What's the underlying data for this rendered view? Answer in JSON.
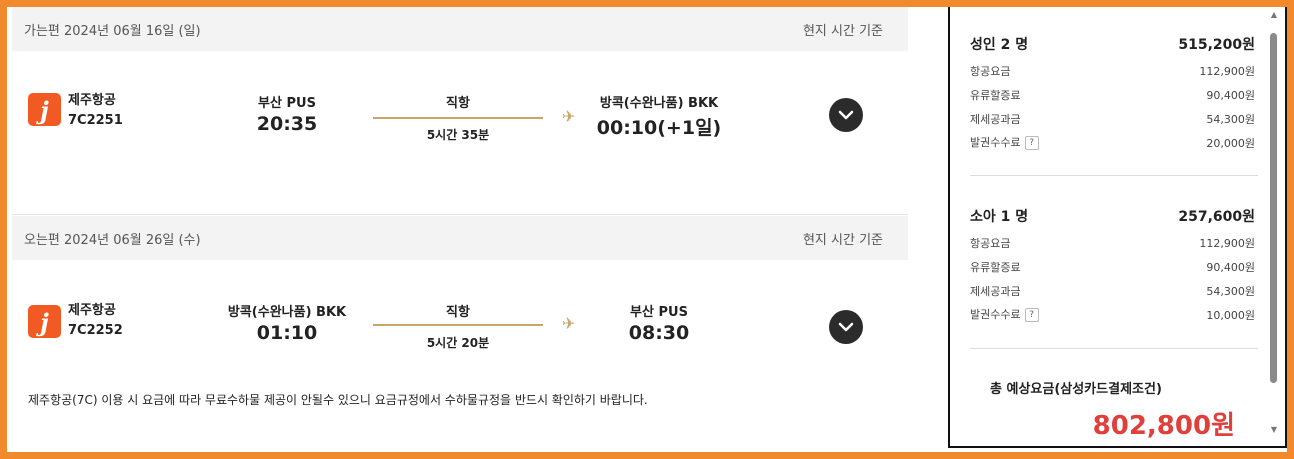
{
  "outbound": {
    "header_date": "가는편 2024년 06월 16일 (일)",
    "header_tz": "현지 시간 기준",
    "airline": "제주항공",
    "flight_no": "7C2251",
    "logo_letter": "j",
    "dep_city": "부산 PUS",
    "dep_time": "20:35",
    "route": "직항",
    "duration": "5시간 35분",
    "arr_city": "방콕(수완나품) BKK",
    "arr_time": "00:10(+1일)"
  },
  "inbound": {
    "header_date": "오는편 2024년 06월 26일 (수)",
    "header_tz": "현지 시간 기준",
    "airline": "제주항공",
    "flight_no": "7C2252",
    "logo_letter": "j",
    "dep_city": "방콕(수완나품) BKK",
    "dep_time": "01:10",
    "route": "직항",
    "duration": "5시간 20분",
    "arr_city": "부산 PUS",
    "arr_time": "08:30"
  },
  "notice": "제주항공(7C) 이용 시 요금에 따라 무료수하물 제공이 안될수 있으니 요금규정에서 수하물규정을 반드시 확인하기 바랍니다.",
  "summary": {
    "adult": {
      "title": "성인 2 명",
      "total": "515,200원",
      "rows": [
        {
          "label": "항공요금",
          "value": "112,900원"
        },
        {
          "label": "유류할증료",
          "value": "90,400원"
        },
        {
          "label": "제세공과금",
          "value": "54,300원"
        },
        {
          "label": "발권수수료",
          "value": "20,000원"
        }
      ]
    },
    "child": {
      "title": "소아 1 명",
      "total": "257,600원",
      "rows": [
        {
          "label": "항공요금",
          "value": "112,900원"
        },
        {
          "label": "유류할증료",
          "value": "90,400원"
        },
        {
          "label": "제세공과금",
          "value": "54,300원"
        },
        {
          "label": "발권수수료",
          "value": "10,000원"
        }
      ]
    },
    "help_mark": "?",
    "total_label": "총 예상요금(삼성카드결제조건)",
    "total_amount": "802,800원"
  },
  "colors": {
    "frame_orange": "#f08a2c",
    "airline_logo": "#f15a22",
    "route_gold": "#c9a668",
    "total_red": "#e0403c"
  },
  "icons": {
    "plane": "✈",
    "expand": "chevron-down-icon"
  }
}
